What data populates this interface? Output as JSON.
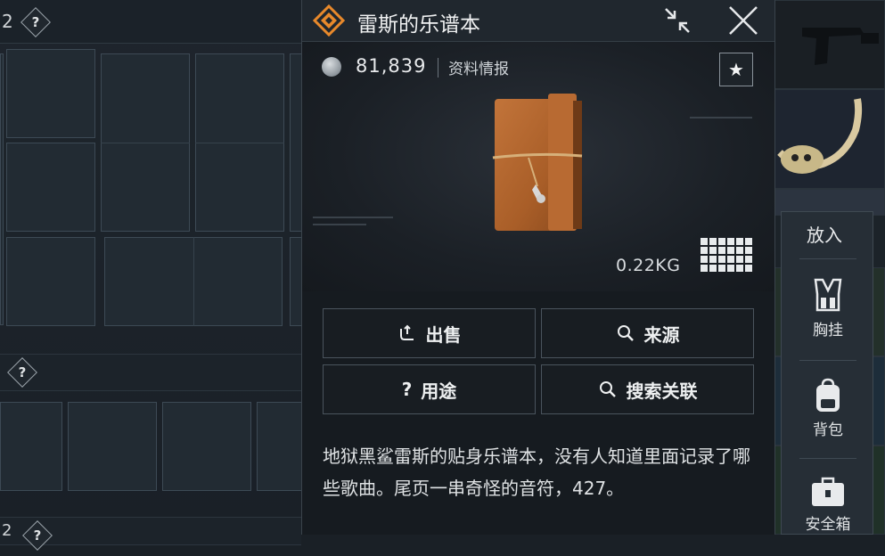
{
  "left": {
    "slot_count": "2",
    "help_marks": [
      "?",
      "?",
      "?"
    ],
    "bottom_slot_count": "2"
  },
  "item_panel": {
    "title": "雷斯的乐谱本",
    "price": "81,839",
    "info_link": "资料情报",
    "favorite_icon": "star-icon",
    "weight": "0.22KG",
    "size_grid": {
      "cols": 6,
      "rows": 4
    },
    "actions": [
      {
        "label": "出售",
        "icon": "sell-icon"
      },
      {
        "label": "来源",
        "icon": "search-icon"
      },
      {
        "label": "用途",
        "icon": "question-icon"
      },
      {
        "label": "搜索关联",
        "icon": "search-icon"
      }
    ],
    "description": "地狱黑鲨雷斯的贴身乐谱本，没有人知道里面记录了哪些歌曲。尾页一串奇怪的音符，427。"
  },
  "side_menu": {
    "title": "放入",
    "items": [
      {
        "label": "胸挂",
        "icon": "chest-rig-icon"
      },
      {
        "label": "背包",
        "icon": "backpack-icon"
      },
      {
        "label": "安全箱",
        "icon": "safe-box-icon"
      }
    ]
  },
  "colors": {
    "accent_orange": "#e8892b",
    "panel_bg": "#161b20",
    "item_leather": "#b5652b"
  }
}
